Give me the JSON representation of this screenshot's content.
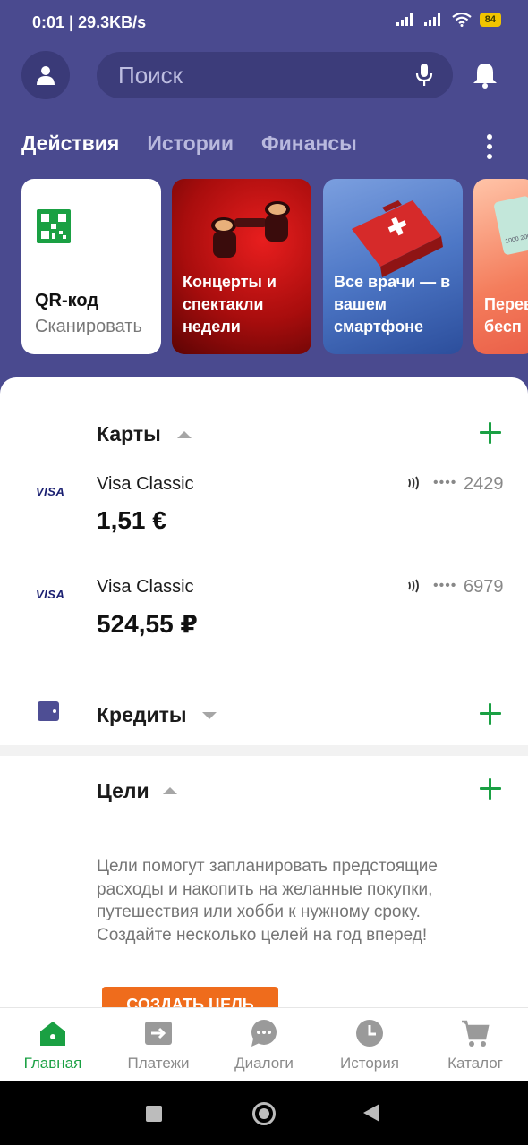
{
  "status_bar": {
    "time": "0:01 | 29.3KB/s",
    "battery": "84"
  },
  "header": {
    "search_placeholder": "Поиск"
  },
  "tabs": [
    {
      "label": "Действия",
      "active": true
    },
    {
      "label": "Истории",
      "active": false
    },
    {
      "label": "Финансы",
      "active": false
    }
  ],
  "stories": {
    "qr": {
      "title": "QR-код",
      "subtitle": "Сканировать"
    },
    "concerts": "Концерты и спектакли недели",
    "doctors": "Все врачи — в вашем смартфоне",
    "transfers": "Перев карты бесп",
    "transfer_card_text": "1000 200"
  },
  "sections": {
    "cards": {
      "title": "Карты",
      "items": [
        {
          "brand": "VISA",
          "name": "Visa Classic",
          "balance": "1,51 €",
          "masked": "••••",
          "last4": "2429"
        },
        {
          "brand": "VISA",
          "name": "Visa Classic",
          "balance": "524,55 ₽",
          "masked": "••••",
          "last4": "6979"
        }
      ]
    },
    "credits": {
      "title": "Кредиты"
    },
    "goals": {
      "title": "Цели",
      "description": "Цели помогут запланировать предстоящие расходы и накопить на желанные покупки, путешествия или хобби к нужному сроку. Создайте несколько целей на год вперед!",
      "button_label": "СОЗДАТЬ ЦЕЛЬ"
    }
  },
  "bottom_nav": [
    {
      "label": "Главная",
      "icon": "home-icon",
      "active": true
    },
    {
      "label": "Платежи",
      "icon": "payments-icon",
      "active": false
    },
    {
      "label": "Диалоги",
      "icon": "dialogs-icon",
      "active": false
    },
    {
      "label": "История",
      "icon": "history-icon",
      "active": false
    },
    {
      "label": "Каталог",
      "icon": "cart-icon",
      "active": false
    }
  ],
  "colors": {
    "header_bg": "#4a4a8f",
    "accent_green": "#1aa043",
    "cta_orange": "#ef6c1c"
  }
}
